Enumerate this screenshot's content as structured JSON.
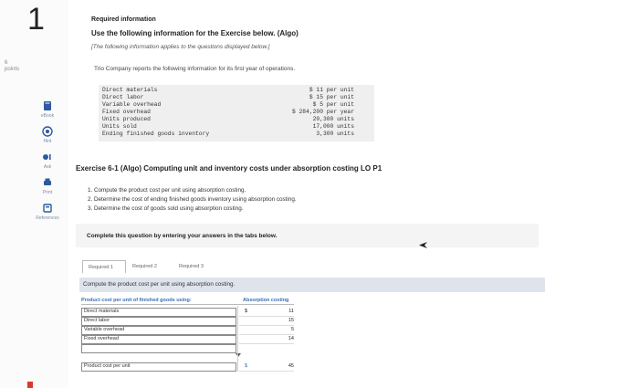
{
  "question_number": "1",
  "points": "6\npoints",
  "nav": [
    {
      "label": "eBook",
      "icon": "book-icon"
    },
    {
      "label": "Hint",
      "icon": "hint-icon"
    },
    {
      "label": "Ask",
      "icon": "ask-icon"
    },
    {
      "label": "Print",
      "icon": "print-icon"
    },
    {
      "label": "References",
      "icon": "references-icon"
    }
  ],
  "header": {
    "required_info": "Required information",
    "title": "Use the following information for the Exercise below. (Algo)",
    "note": "[The following information applies to the questions displayed below.]",
    "intro": "Trio Company reports the following information for its first year of operations."
  },
  "data_rows": [
    {
      "label": "Direct materials",
      "value": "$ 11 per unit"
    },
    {
      "label": "Direct labor",
      "value": "$ 15 per unit"
    },
    {
      "label": "Variable overhead",
      "value": "$ 5 per unit"
    },
    {
      "label": "Fixed overhead",
      "value": "$ 284,200 per year"
    },
    {
      "label": "Units produced",
      "value": "20,300 units"
    },
    {
      "label": "Units sold",
      "value": "17,000 units"
    },
    {
      "label": "Ending finished goods inventory",
      "value": "3,300 units"
    }
  ],
  "exercise": {
    "title": "Exercise 6-1 (Algo) Computing unit and inventory costs under absorption costing LO P1",
    "steps": [
      "1. Compute the product cost per unit using absorption costing.",
      "2. Determine the cost of ending finished goods inventory using absorption costing.",
      "3. Determine the cost of goods sold using absorption costing."
    ],
    "instruction": "Complete this question by entering your answers in the tabs below."
  },
  "tabs": [
    "Required 1",
    "Required 2",
    "Required 3"
  ],
  "panel_text": "Compute the product cost per unit using absorption costing.",
  "table": {
    "header_left": "Product cost per unit of finished goods using:",
    "header_right": "Absorption costing",
    "rows": [
      {
        "label": "Direct materials",
        "currency": "$",
        "value": "11"
      },
      {
        "label": "Direct labor",
        "currency": "",
        "value": "15"
      },
      {
        "label": "Variable overhead",
        "currency": "",
        "value": "5"
      },
      {
        "label": "Fixed overhead",
        "currency": "",
        "value": "14"
      }
    ],
    "total_label": "Product cost per unit",
    "total_currency": "$",
    "total_value": "45"
  },
  "colors": {
    "accent": "#3b6fb6",
    "panel": "#dfe4ec",
    "red": "#d9382c"
  }
}
